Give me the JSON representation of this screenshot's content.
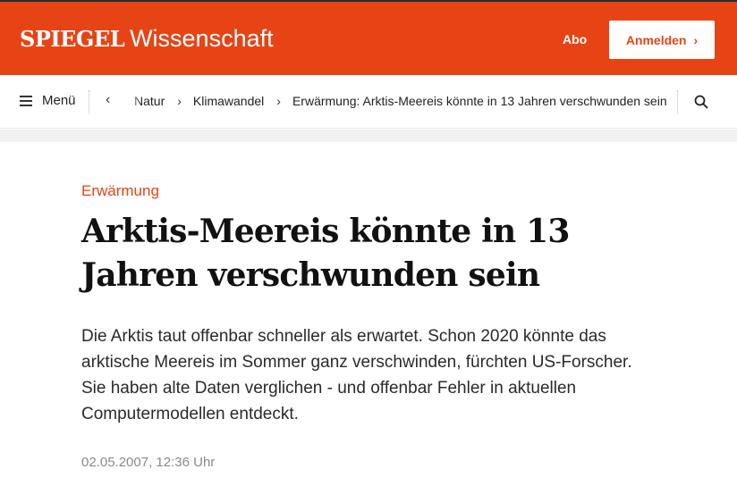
{
  "header": {
    "logo_brand": "SPIEGEL",
    "logo_section": "Wissenschaft",
    "abo_label": "Abo",
    "login_label": "Anmelden",
    "accent_color": "#e64415"
  },
  "nav": {
    "menu_label": "Menü",
    "breadcrumbs": [
      "Natur",
      "Klimawandel",
      "Erwärmung: Arktis-Meereis könnte in 13 Jahren verschwunden sein"
    ],
    "icons": [
      "hamburger-icon",
      "chevron-left-icon",
      "chevron-right-icon",
      "search-icon"
    ]
  },
  "article": {
    "kicker": "Erwärmung",
    "headline": "Arktis-Meereis könnte in 13 Jahren verschwunden sein",
    "teaser": "Die Arktis taut offenbar schneller als erwartet. Schon 2020 könnte das arktische Meereis im Sommer ganz verschwinden, fürchten US-Forscher. Sie haben alte Daten verglichen - und offenbar Fehler in aktuellen Computermodellen entdeckt.",
    "date": "02.05.2007, 12:36 Uhr"
  }
}
